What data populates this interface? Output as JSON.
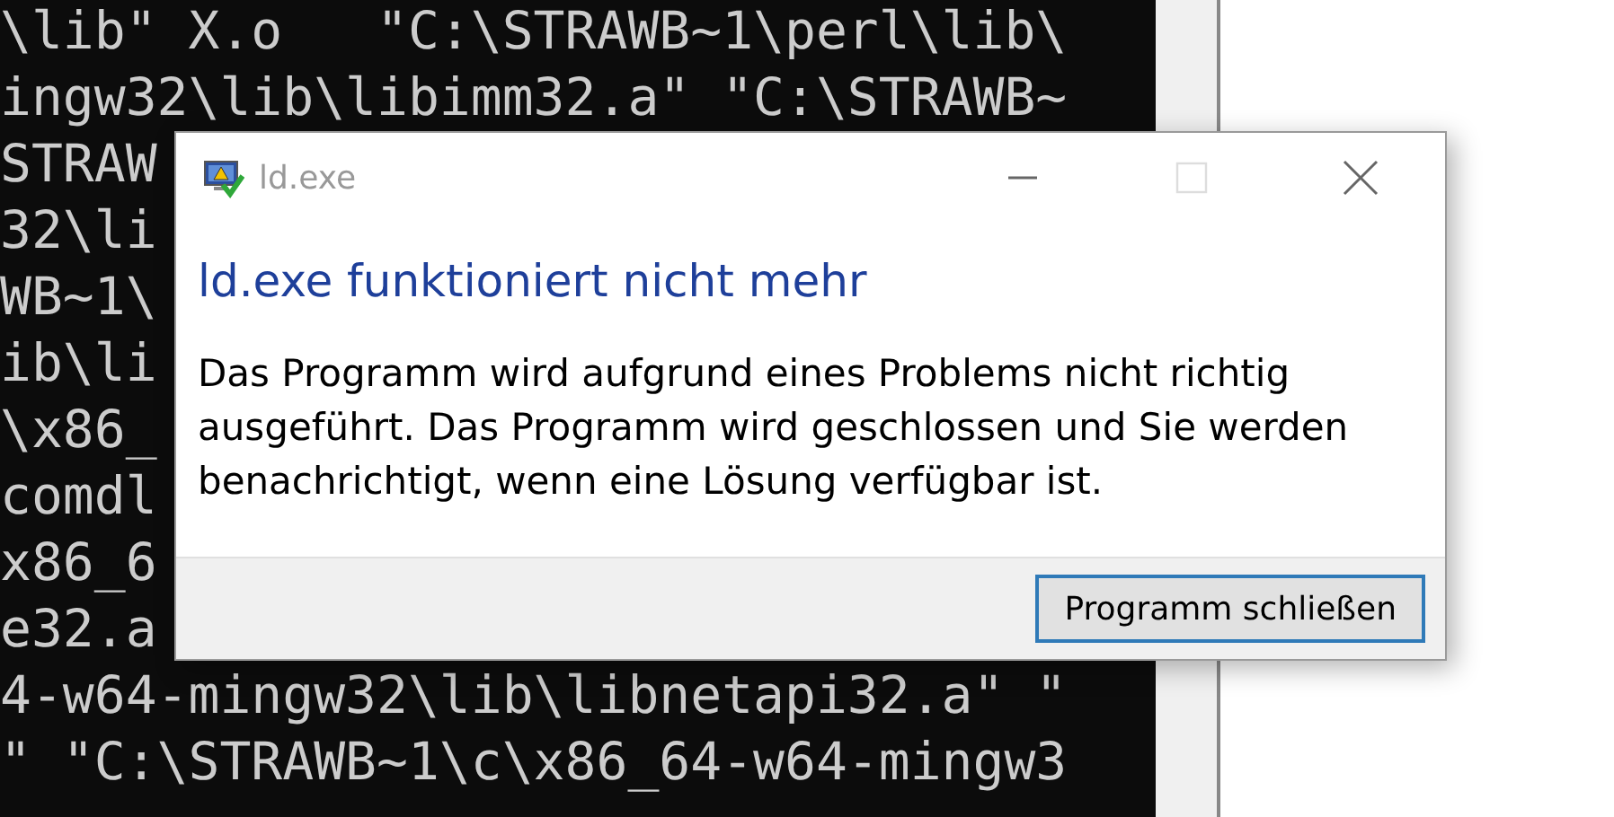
{
  "console": {
    "lines": [
      "\\lib\" X.o   \"C:\\STRAWB~1\\perl\\lib\\",
      "ingw32\\lib\\libimm32.a\" \"C:\\STRAWB~",
      "STRAW",
      "32\\li",
      "WB~1\\",
      "ib\\li",
      "\\x86_",
      "comdl",
      "x86_6",
      "e32.a",
      "4-w64-mingw32\\lib\\libnetapi32.a\" \"",
      "\" \"C:\\STRAWB~1\\c\\x86_64-w64-mingw3"
    ]
  },
  "dialog": {
    "title": "ld.exe",
    "controls": [
      {
        "kind": "minimize",
        "disabled": false
      },
      {
        "kind": "maximize",
        "disabled": true
      },
      {
        "kind": "close",
        "disabled": false
      }
    ],
    "heading": "ld.exe funktioniert nicht mehr",
    "message": "Das Programm wird aufgrund eines Problems nicht richtig ausgeführt. Das Programm wird geschlossen und Sie werden benachrichtigt, wenn eine Lösung verfügbar ist.",
    "buttons": [
      {
        "label": "Programm schließen",
        "default": true
      }
    ]
  }
}
